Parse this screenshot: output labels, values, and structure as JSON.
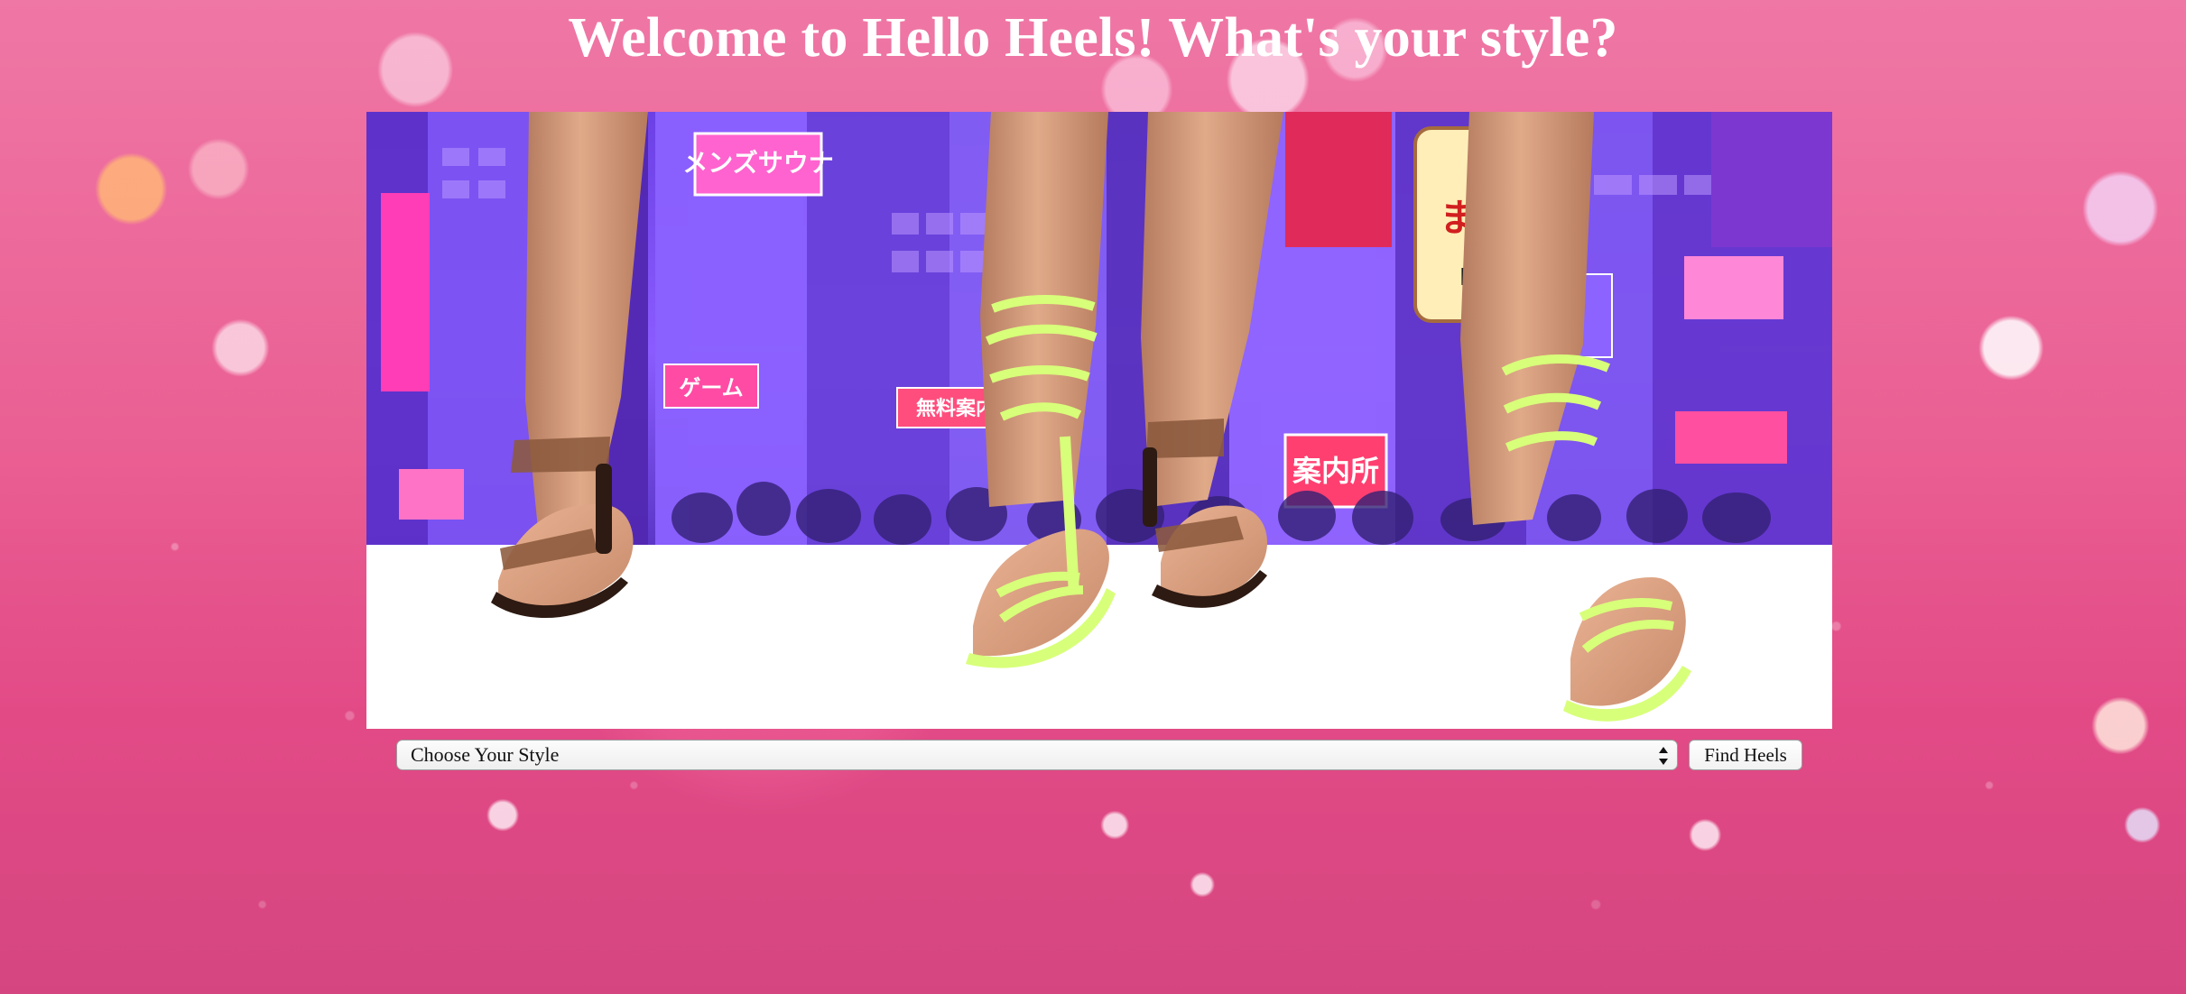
{
  "page": {
    "title": "Welcome to Hello Heels! What's your style?"
  },
  "hero_image": {
    "description_name": "heels-banner",
    "signs": [
      "メンズサウナ",
      "ゲーム",
      "無料案内所",
      "案内所",
      "まっ",
      "B1"
    ]
  },
  "form": {
    "select_value": "Choose Your Style",
    "button_label": "Find Heels"
  },
  "colors": {
    "background_pink": "#e95a91",
    "title_color": "#ffffff",
    "neon_purple": "#7a49e7",
    "heel_green": "#d8ff7a",
    "heel_brown": "#8c5a3e"
  }
}
